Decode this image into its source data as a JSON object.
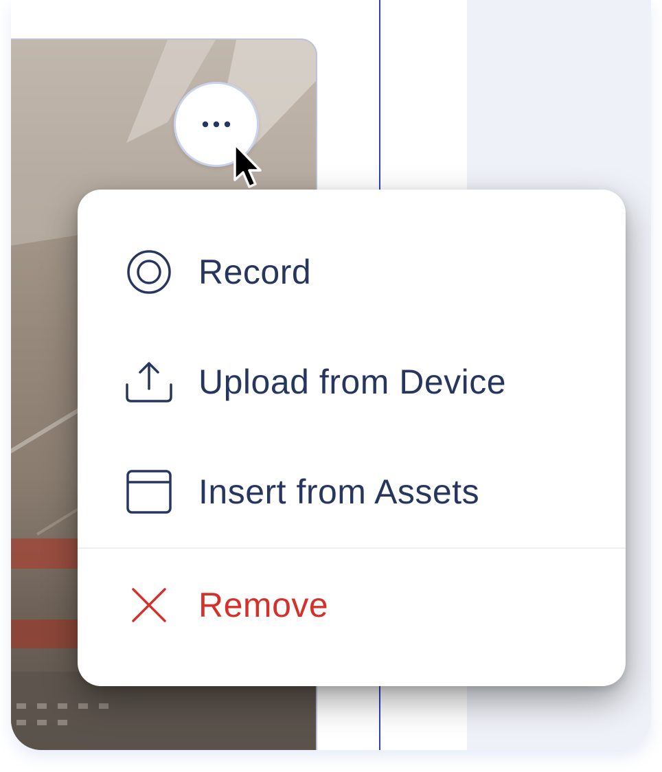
{
  "more_button": {
    "icon": "more-horizontal-icon"
  },
  "menu": {
    "items": [
      {
        "label": "Record",
        "icon": "record-icon"
      },
      {
        "label": "Upload from Device",
        "icon": "upload-icon"
      },
      {
        "label": "Insert from Assets",
        "icon": "assets-window-icon"
      }
    ],
    "remove": {
      "label": "Remove",
      "icon": "close-x-icon"
    }
  },
  "colors": {
    "menu_text": "#27365f",
    "danger_text": "#d5302a",
    "guide_line": "#2f3fc4",
    "right_panel": "#eef1f7"
  }
}
